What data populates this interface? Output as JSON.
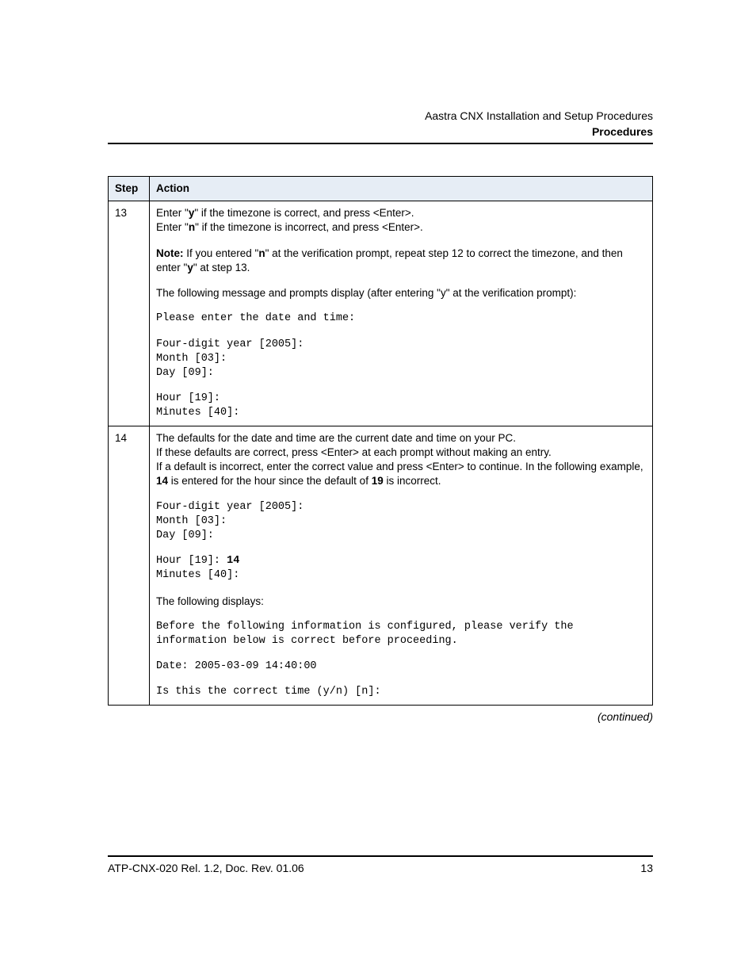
{
  "header": {
    "doc_title": "Aastra CNX Installation and Setup Procedures",
    "section": "Procedures"
  },
  "table": {
    "col_step": "Step",
    "col_action": "Action",
    "rows": [
      {
        "num": "13",
        "p1a": "Enter \"",
        "p1b": "y",
        "p1c": "\" if the timezone is correct, and press <Enter>.",
        "p2a": "Enter \"",
        "p2b": "n",
        "p2c": "\" if the timezone is incorrect, and press <Enter>.",
        "note_label": "Note:",
        "note_a": " If you entered \"",
        "note_b": "n",
        "note_c": "\" at the verification prompt, repeat step 12 to correct the timezone, and then enter \"",
        "note_d": "y",
        "note_e": "\" at step 13.",
        "p3": "The following message and prompts display (after entering \"y\" at the verification prompt):",
        "code1": "Please enter the date and time:",
        "code2": "Four-digit year [2005]:\nMonth [03]:\nDay [09]:",
        "code3": "Hour [19]:\nMinutes [40]:"
      },
      {
        "num": "14",
        "p1": "The defaults for the date and time are the current date and time on your PC.",
        "p2": "If these defaults are correct, press <Enter> at each prompt without making an entry.",
        "p3a": "If a default is incorrect, enter the correct value and press <Enter> to continue. In the following example, ",
        "p3b": "14",
        "p3c": " is entered for the hour since the default of ",
        "p3d": "19",
        "p3e": " is incorrect.",
        "code1": "Four-digit year [2005]:\nMonth [03]:\nDay [09]:",
        "code2a": "Hour [19]: ",
        "code2b": "14",
        "code2c": "\nMinutes [40]:",
        "p4": "The following displays:",
        "code3": "Before the following information is configured, please verify the information below is correct before proceeding.",
        "code4": "Date: 2005-03-09 14:40:00",
        "code5": "Is this the correct time (y/n) [n]:"
      }
    ]
  },
  "continued": "(continued)",
  "footer": {
    "left": "ATP-CNX-020 Rel. 1.2, Doc. Rev. 01.06",
    "right": "13"
  }
}
